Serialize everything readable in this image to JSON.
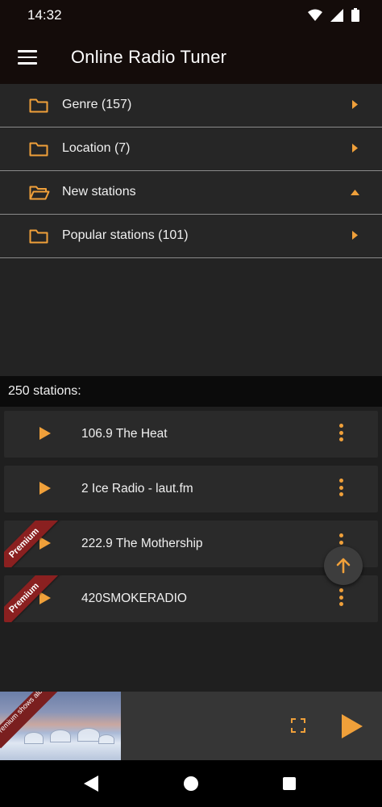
{
  "status_bar": {
    "time": "14:32",
    "icons": [
      "wifi-icon",
      "signal-icon",
      "battery-icon"
    ]
  },
  "app_bar": {
    "title": "Online Radio Tuner",
    "menu_icon": "menu-icon"
  },
  "folders": [
    {
      "label": "Genre (157)",
      "state": "collapsed"
    },
    {
      "label": "Location (7)",
      "state": "collapsed"
    },
    {
      "label": "New stations",
      "state": "expanded"
    },
    {
      "label": "Popular stations (101)",
      "state": "collapsed"
    }
  ],
  "station_count": "250 stations:",
  "stations": [
    {
      "name": "106.9 The Heat",
      "premium": false
    },
    {
      "name": "2 Ice Radio - laut.fm",
      "premium": false
    },
    {
      "name": "222.9 The Mothership",
      "premium": true,
      "badge": "Premium"
    },
    {
      "name": "420SMOKERADIO",
      "premium": true,
      "badge": "Premium"
    }
  ],
  "player": {
    "art_banner": "Premium shows album art"
  },
  "colors": {
    "accent": "#f0a03a",
    "ribbon": "#8a2020",
    "background": "#1f1f1f",
    "appbar": "#140c0a"
  }
}
